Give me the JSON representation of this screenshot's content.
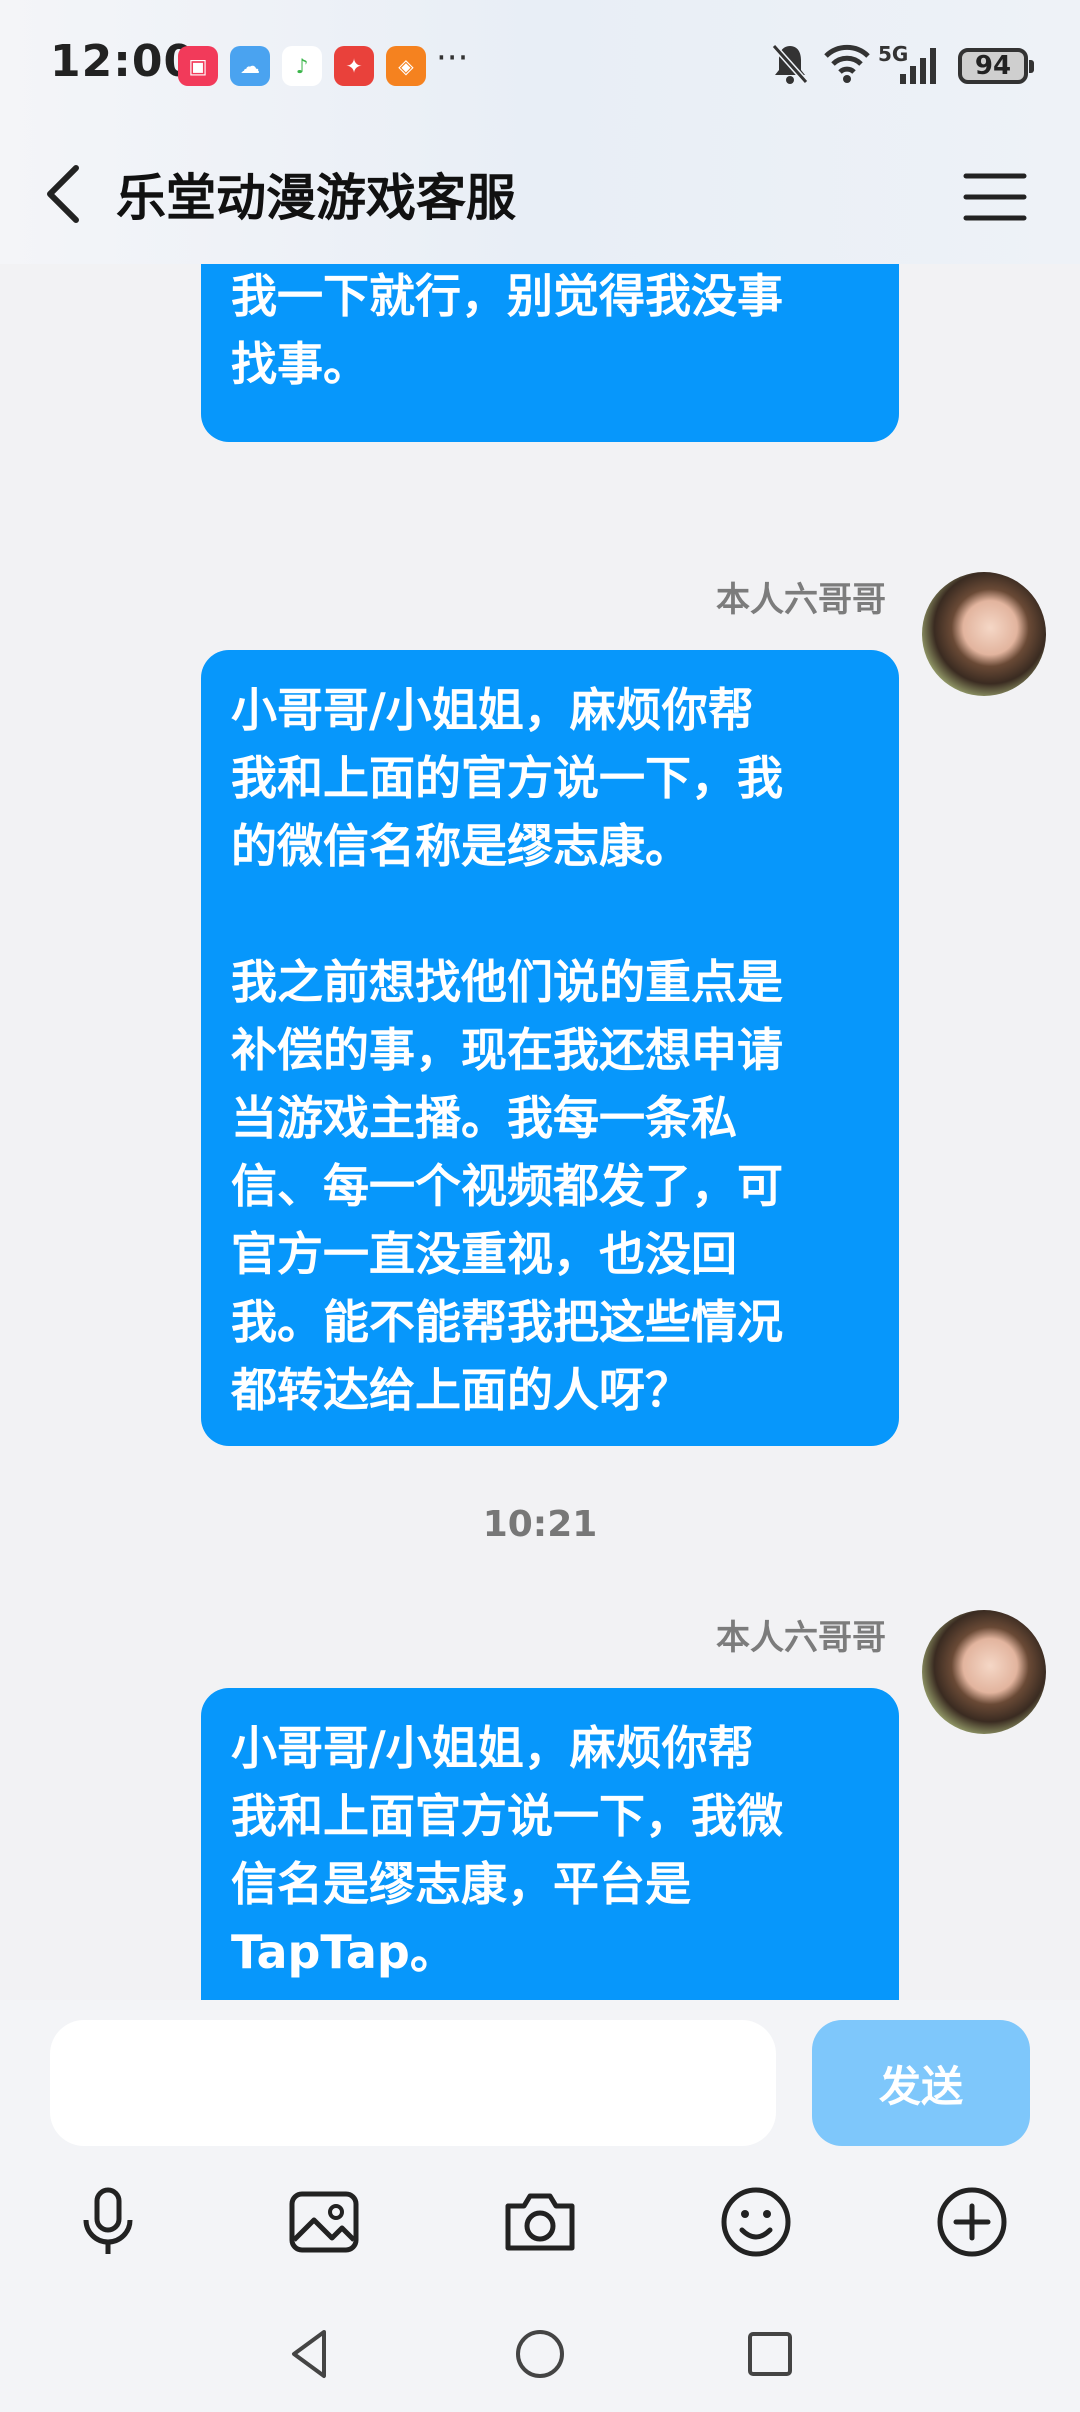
{
  "status_bar": {
    "time": "12:00",
    "app_icons": [
      "camera-app-icon",
      "weather-icon",
      "music-icon",
      "game-app-icon",
      "shopping-app-icon"
    ],
    "more": "···",
    "network": "5G",
    "battery": "94"
  },
  "header": {
    "title": "乐堂动漫游戏客服"
  },
  "messages": [
    {
      "text": "我一下就行，别觉得我没事\n找事。"
    },
    {
      "sender": "本人六哥哥",
      "text": "小哥哥/小姐姐，麻烦你帮\n我和上面的官方说一下，我\n的微信名称是缪志康。\n\n我之前想找他们说的重点是\n补偿的事，现在我还想申请\n当游戏主播。我每一条私\n信、每一个视频都发了，可\n官方一直没重视，也没回\n我。能不能帮我把这些情况\n都转达给上面的人呀？"
    },
    {
      "timestamp": "10:21"
    },
    {
      "sender": "本人六哥哥",
      "text": "小哥哥/小姐姐，麻烦你帮\n我和上面官方说一下，我微\n信名是缪志康，平台是\nTapTap。"
    }
  ],
  "input": {
    "placeholder": "",
    "send_label": "发送"
  },
  "toolbar": [
    "microphone-icon",
    "image-icon",
    "camera-icon",
    "emoji-icon",
    "plus-icon"
  ],
  "colors": {
    "bubble": "#0797fb",
    "send_disabled": "#7ec7fb",
    "background": "#f2f2f4"
  }
}
